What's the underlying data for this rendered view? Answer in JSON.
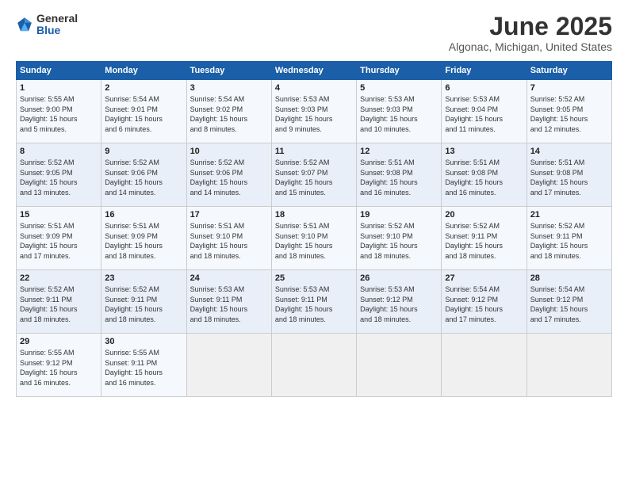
{
  "logo": {
    "general": "General",
    "blue": "Blue"
  },
  "header": {
    "title": "June 2025",
    "subtitle": "Algonac, Michigan, United States"
  },
  "weekdays": [
    "Sunday",
    "Monday",
    "Tuesday",
    "Wednesday",
    "Thursday",
    "Friday",
    "Saturday"
  ],
  "weeks": [
    [
      {
        "day": "1",
        "info": "Sunrise: 5:55 AM\nSunset: 9:00 PM\nDaylight: 15 hours\nand 5 minutes."
      },
      {
        "day": "2",
        "info": "Sunrise: 5:54 AM\nSunset: 9:01 PM\nDaylight: 15 hours\nand 6 minutes."
      },
      {
        "day": "3",
        "info": "Sunrise: 5:54 AM\nSunset: 9:02 PM\nDaylight: 15 hours\nand 8 minutes."
      },
      {
        "day": "4",
        "info": "Sunrise: 5:53 AM\nSunset: 9:03 PM\nDaylight: 15 hours\nand 9 minutes."
      },
      {
        "day": "5",
        "info": "Sunrise: 5:53 AM\nSunset: 9:03 PM\nDaylight: 15 hours\nand 10 minutes."
      },
      {
        "day": "6",
        "info": "Sunrise: 5:53 AM\nSunset: 9:04 PM\nDaylight: 15 hours\nand 11 minutes."
      },
      {
        "day": "7",
        "info": "Sunrise: 5:52 AM\nSunset: 9:05 PM\nDaylight: 15 hours\nand 12 minutes."
      }
    ],
    [
      {
        "day": "8",
        "info": "Sunrise: 5:52 AM\nSunset: 9:05 PM\nDaylight: 15 hours\nand 13 minutes."
      },
      {
        "day": "9",
        "info": "Sunrise: 5:52 AM\nSunset: 9:06 PM\nDaylight: 15 hours\nand 14 minutes."
      },
      {
        "day": "10",
        "info": "Sunrise: 5:52 AM\nSunset: 9:06 PM\nDaylight: 15 hours\nand 14 minutes."
      },
      {
        "day": "11",
        "info": "Sunrise: 5:52 AM\nSunset: 9:07 PM\nDaylight: 15 hours\nand 15 minutes."
      },
      {
        "day": "12",
        "info": "Sunrise: 5:51 AM\nSunset: 9:08 PM\nDaylight: 15 hours\nand 16 minutes."
      },
      {
        "day": "13",
        "info": "Sunrise: 5:51 AM\nSunset: 9:08 PM\nDaylight: 15 hours\nand 16 minutes."
      },
      {
        "day": "14",
        "info": "Sunrise: 5:51 AM\nSunset: 9:08 PM\nDaylight: 15 hours\nand 17 minutes."
      }
    ],
    [
      {
        "day": "15",
        "info": "Sunrise: 5:51 AM\nSunset: 9:09 PM\nDaylight: 15 hours\nand 17 minutes."
      },
      {
        "day": "16",
        "info": "Sunrise: 5:51 AM\nSunset: 9:09 PM\nDaylight: 15 hours\nand 18 minutes."
      },
      {
        "day": "17",
        "info": "Sunrise: 5:51 AM\nSunset: 9:10 PM\nDaylight: 15 hours\nand 18 minutes."
      },
      {
        "day": "18",
        "info": "Sunrise: 5:51 AM\nSunset: 9:10 PM\nDaylight: 15 hours\nand 18 minutes."
      },
      {
        "day": "19",
        "info": "Sunrise: 5:52 AM\nSunset: 9:10 PM\nDaylight: 15 hours\nand 18 minutes."
      },
      {
        "day": "20",
        "info": "Sunrise: 5:52 AM\nSunset: 9:11 PM\nDaylight: 15 hours\nand 18 minutes."
      },
      {
        "day": "21",
        "info": "Sunrise: 5:52 AM\nSunset: 9:11 PM\nDaylight: 15 hours\nand 18 minutes."
      }
    ],
    [
      {
        "day": "22",
        "info": "Sunrise: 5:52 AM\nSunset: 9:11 PM\nDaylight: 15 hours\nand 18 minutes."
      },
      {
        "day": "23",
        "info": "Sunrise: 5:52 AM\nSunset: 9:11 PM\nDaylight: 15 hours\nand 18 minutes."
      },
      {
        "day": "24",
        "info": "Sunrise: 5:53 AM\nSunset: 9:11 PM\nDaylight: 15 hours\nand 18 minutes."
      },
      {
        "day": "25",
        "info": "Sunrise: 5:53 AM\nSunset: 9:11 PM\nDaylight: 15 hours\nand 18 minutes."
      },
      {
        "day": "26",
        "info": "Sunrise: 5:53 AM\nSunset: 9:12 PM\nDaylight: 15 hours\nand 18 minutes."
      },
      {
        "day": "27",
        "info": "Sunrise: 5:54 AM\nSunset: 9:12 PM\nDaylight: 15 hours\nand 17 minutes."
      },
      {
        "day": "28",
        "info": "Sunrise: 5:54 AM\nSunset: 9:12 PM\nDaylight: 15 hours\nand 17 minutes."
      }
    ],
    [
      {
        "day": "29",
        "info": "Sunrise: 5:55 AM\nSunset: 9:12 PM\nDaylight: 15 hours\nand 16 minutes."
      },
      {
        "day": "30",
        "info": "Sunrise: 5:55 AM\nSunset: 9:11 PM\nDaylight: 15 hours\nand 16 minutes."
      },
      {
        "day": "",
        "info": ""
      },
      {
        "day": "",
        "info": ""
      },
      {
        "day": "",
        "info": ""
      },
      {
        "day": "",
        "info": ""
      },
      {
        "day": "",
        "info": ""
      }
    ]
  ]
}
